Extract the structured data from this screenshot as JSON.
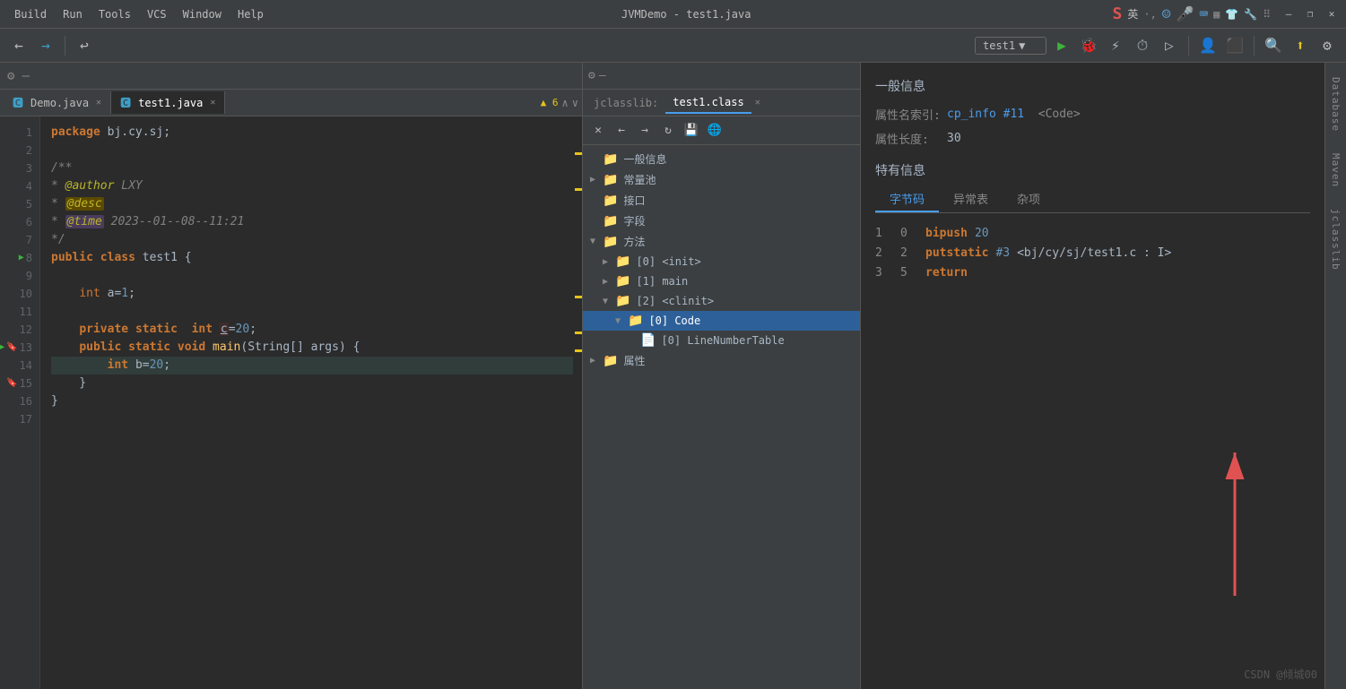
{
  "titlebar": {
    "menu": [
      "Build",
      "Run",
      "Tools",
      "VCS",
      "Window",
      "Help"
    ],
    "app_title": "JVMDemo - test1.java",
    "window_min": "—",
    "window_restore": "❐",
    "window_close": "✕"
  },
  "toolbar": {
    "run_config": "test1",
    "back_tooltip": "Back",
    "forward_tooltip": "Forward"
  },
  "editor": {
    "tabs": [
      {
        "label": "Demo.java",
        "active": false,
        "icon": "java"
      },
      {
        "label": "test1.java",
        "active": true,
        "icon": "java"
      }
    ],
    "warning_count": "▲ 6",
    "lines": [
      {
        "num": 1,
        "code": "<span class='kw'>package</span> <span class='var'>bj.cy.sj</span>;"
      },
      {
        "num": 2,
        "code": ""
      },
      {
        "num": 3,
        "code": "<span class='comment'>/**</span>"
      },
      {
        "num": 4,
        "code": "<span class='comment'> * <span class='annotation'>@author</span> LXY</span>"
      },
      {
        "num": 5,
        "code": "<span class='comment'> * <span style='background:#5c4a00;padding:0 2px;border-radius:2px;'>@desc</span></span>"
      },
      {
        "num": 6,
        "code": "<span class='comment'> * <span style='background:#4a3c5c;padding:0 2px;border-radius:2px;'>@time</span> 2023--01--08--11:21</span>"
      },
      {
        "num": 7,
        "code": "<span class='comment'> */</span>"
      },
      {
        "num": 8,
        "code": "<span class='kw'>public</span> <span class='kw'>class</span> <span class='class-name'>test1</span> {",
        "has_run": true
      },
      {
        "num": 9,
        "code": ""
      },
      {
        "num": 10,
        "code": "    <span class='kw2'>int</span> <span class='var'>a</span>=<span class='num'>1</span>;"
      },
      {
        "num": 11,
        "code": ""
      },
      {
        "num": 12,
        "code": "    <span class='kw'>private</span> <span class='kw2'>static</span>  <span class='kw2'>int</span> <span style='text-decoration:underline;color:#a9b7c6;'>c</span>=<span class='num'>20</span>;"
      },
      {
        "num": 13,
        "code": "    <span class='kw'>public</span> <span class='kw2'>static</span> <span class='kw2'>void</span> <span class='var'>main</span>(<span class='class-name'>String</span>[] <span class='var'>args</span>) {",
        "has_run": true,
        "has_bookmark": true
      },
      {
        "num": 14,
        "code": "        <span class='kw2'>int</span> <span class='var'>b</span>=<span class='num'>20</span>;"
      },
      {
        "num": 15,
        "code": "    }",
        "has_bookmark2": true
      },
      {
        "num": 16,
        "code": "}"
      },
      {
        "num": 17,
        "code": ""
      }
    ]
  },
  "jclasslib": {
    "tab_inactive": "jclasslib:",
    "tab_active": "test1.class",
    "tree": [
      {
        "level": 0,
        "label": "一般信息",
        "arrow": "",
        "expanded": false
      },
      {
        "level": 0,
        "label": "常量池",
        "arrow": "▶",
        "expanded": false
      },
      {
        "level": 0,
        "label": "接口",
        "arrow": "",
        "expanded": false
      },
      {
        "level": 0,
        "label": "字段",
        "arrow": "",
        "expanded": false
      },
      {
        "level": 0,
        "label": "方法",
        "arrow": "▼",
        "expanded": true
      },
      {
        "level": 1,
        "label": "[0] <init>",
        "arrow": "▶",
        "expanded": false
      },
      {
        "level": 1,
        "label": "[1] main",
        "arrow": "▶",
        "expanded": false
      },
      {
        "level": 1,
        "label": "[2] <clinit>",
        "arrow": "▼",
        "expanded": true
      },
      {
        "level": 2,
        "label": "[0] Code",
        "arrow": "▼",
        "expanded": true,
        "selected": true
      },
      {
        "level": 3,
        "label": "[0] LineNumberTable",
        "arrow": "",
        "expanded": false
      },
      {
        "level": 0,
        "label": "属性",
        "arrow": "▶",
        "expanded": false
      }
    ]
  },
  "info": {
    "section_title": "一般信息",
    "attr_name_label": "属性名索引:",
    "attr_name_value": "cp_info #11",
    "attr_name_code": "<Code>",
    "attr_length_label": "属性长度:",
    "attr_length_value": "30",
    "special_title": "特有信息",
    "bytecode_tabs": [
      "字节码",
      "异常表",
      "杂项"
    ],
    "active_tab": "字节码",
    "bytecode_lines": [
      {
        "line": "1",
        "offset": "0",
        "instr": "bipush",
        "arg": "20",
        "arg_type": "num"
      },
      {
        "line": "2",
        "offset": "2",
        "instr": "putstatic",
        "arg": "#3",
        "arg_ref": "<bj/cy/sj/test1.c : I>",
        "arg_type": "ref"
      },
      {
        "line": "3",
        "offset": "5",
        "instr": "return",
        "arg": "",
        "arg_type": "none"
      }
    ]
  },
  "sidebar_right": {
    "labels": [
      "Database",
      "Maven",
      "jclasslib"
    ]
  },
  "watermark": "CSDN @倾城00",
  "gutter_marks": [
    {
      "pos": 1,
      "type": "yellow"
    },
    {
      "pos": 2,
      "type": "yellow"
    },
    {
      "pos": 3,
      "type": "yellow"
    },
    {
      "pos": 4,
      "type": "yellow"
    }
  ]
}
